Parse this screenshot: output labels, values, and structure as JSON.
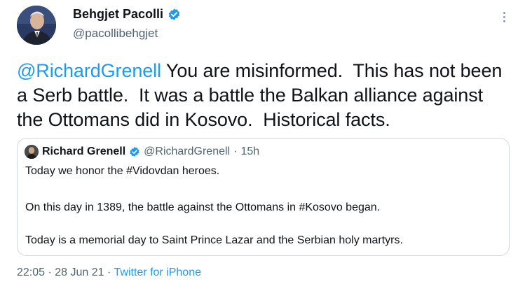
{
  "author": {
    "display_name": "Behgjet Pacolli",
    "handle": "@pacollibehgjet",
    "verified": true
  },
  "tweet": {
    "mention": "@RichardGrenell",
    "text_line1": " You are misinformed.  This has not been",
    "text_line2": "a Serb battle.  It was a battle the Balkan alliance against",
    "text_line3": "the Ottomans did in Kosovo.  Historical facts."
  },
  "quoted_tweet": {
    "display_name": "Richard Grenell",
    "handle": "@RichardGrenell",
    "separator": "·",
    "age": "15h",
    "line1": "Today we honor the #Vidovdan heroes.",
    "line2": "On this day in 1389, the battle against the Ottomans in #Kosovo began.",
    "line3": "Today is a memorial day to Saint Prince Lazar and the Serbian holy martyrs."
  },
  "footer": {
    "time": "22:05",
    "sep1": "·",
    "date": "28 Jun 21",
    "sep2": "·",
    "source": "Twitter for iPhone"
  },
  "colors": {
    "link": "#1d9bf0",
    "muted": "#536471",
    "text": "#0f1419",
    "border": "#cfd9de"
  },
  "icons": [
    "verified-badge-icon",
    "more-options-icon",
    "avatar"
  ]
}
